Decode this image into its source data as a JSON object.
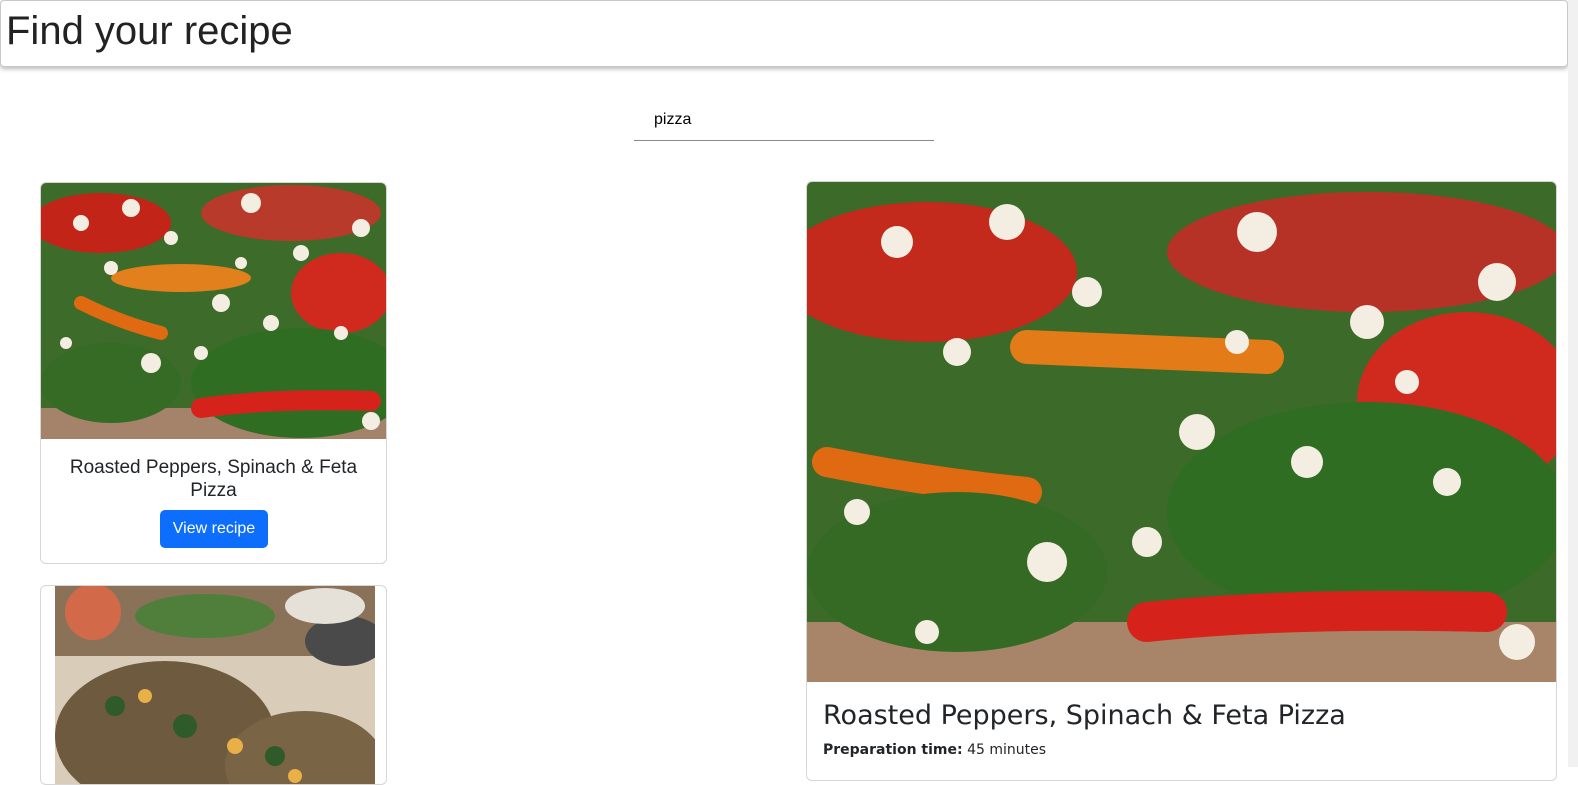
{
  "header": {
    "title": "Find your recipe"
  },
  "search": {
    "value": "pizza",
    "placeholder": ""
  },
  "results": [
    {
      "title": "Roasted Peppers, Spinach & Feta Pizza",
      "button_label": "View recipe",
      "image": "roasted-peppers-spinach-feta-pizza"
    },
    {
      "title": "",
      "image": "grilled-peach-arugula-flatbread"
    }
  ],
  "detail": {
    "title": "Roasted Peppers, Spinach & Feta Pizza",
    "prep_label": "Preparation time:",
    "prep_value": "45 minutes",
    "image": "roasted-peppers-spinach-feta-pizza"
  },
  "colors": {
    "primary": "#0d6efd",
    "text": "#212529",
    "border": "#d6d6d6"
  }
}
